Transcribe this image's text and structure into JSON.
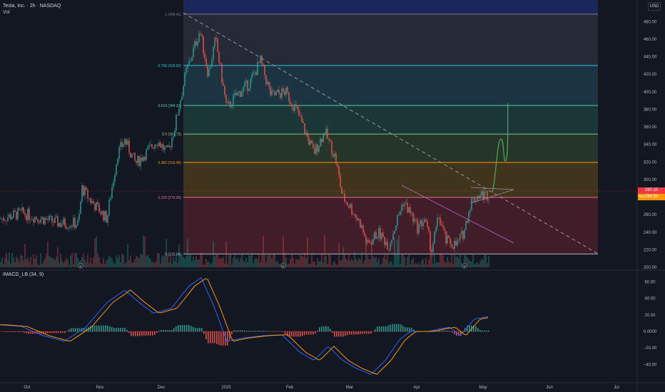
{
  "header": {
    "title": "Tesla, Inc. · 2h · NASDAQ",
    "volume_label": "Vol"
  },
  "currency_button": "USD",
  "price_axis": {
    "ticks": [
      "480.00",
      "460.00",
      "440.00",
      "420.00",
      "400.00",
      "380.00",
      "360.00",
      "340.00",
      "320.00",
      "300.00",
      "280.00",
      "260.00",
      "240.00",
      "220.00",
      "200.00"
    ],
    "tick_values": [
      480,
      460,
      440,
      420,
      400,
      380,
      360,
      340,
      320,
      300,
      280,
      260,
      240,
      220,
      200
    ]
  },
  "indicator": {
    "label": "IMACD_LB (34, 9)",
    "ticks": [
      "60.00",
      "40.00",
      "20.00",
      "0.0000",
      "−20.00",
      "−40.00"
    ],
    "tick_values": [
      60,
      40,
      20,
      0,
      -20,
      -40
    ]
  },
  "time_axis": {
    "labels": [
      "Oct",
      "Nov",
      "Dec",
      "2025",
      "Feb",
      "Mar",
      "Apr",
      "May",
      "Jun",
      "Jul"
    ]
  },
  "fibonacci": {
    "levels": [
      {
        "label": "1 (488.41)",
        "value": 488.41,
        "color": "#787b86",
        "fill": "#2a2e39"
      },
      {
        "label": "0.786 (429.92)",
        "value": 429.92,
        "color": "#26c6da",
        "fill": "#1f3a46"
      },
      {
        "label": "0.618 (384.33)",
        "value": 384.33,
        "color": "#4dd0a8",
        "fill": "#1d3c3a"
      },
      {
        "label": "0.5 (351.73)",
        "value": 351.73,
        "color": "#81c784",
        "fill": "#2a3b2c"
      },
      {
        "label": "0.382 (319.49)",
        "value": 319.49,
        "color": "#ff9800",
        "fill": "#4a3a1c"
      },
      {
        "label": "0.236 (279.58)",
        "value": 279.58,
        "color": "#f06292",
        "fill": "#4a1f2c"
      },
      {
        "label": "0 (215.08)",
        "value": 215.08,
        "color": "#b2b5be",
        "fill": ""
      }
    ],
    "top_color": "#1e2a6a"
  },
  "price_tags": {
    "last": {
      "value": "287.25",
      "color": "#f23645"
    },
    "line": {
      "name": "Nov",
      "value": "284.59",
      "color": "#ff9800"
    }
  },
  "event_markers": [
    "E",
    "E",
    "E"
  ],
  "colors": {
    "up": "#26a69a",
    "down": "#ef5350",
    "macd": "#2962ff",
    "signal": "#ff9800",
    "projection": "#4caf50",
    "trend": "#9598a1"
  }
}
